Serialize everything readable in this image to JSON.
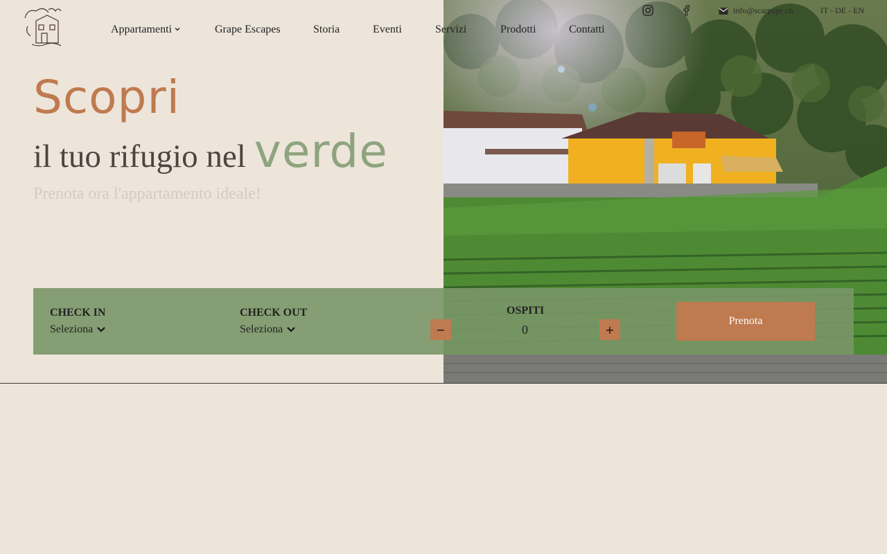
{
  "header": {
    "nav": [
      {
        "label": "Appartamenti",
        "has_dropdown": true
      },
      {
        "label": "Grape Escapes"
      },
      {
        "label": "Storia"
      },
      {
        "label": "Eventi"
      },
      {
        "label": "Servizi"
      },
      {
        "label": "Prodotti"
      },
      {
        "label": "Contatti"
      }
    ],
    "email": "info@scarpape.ch",
    "languages": "IT - DE - EN"
  },
  "hero": {
    "title_word": "Scopri",
    "subtitle_plain": "il tuo rifugio nel",
    "subtitle_accent": "verde",
    "tagline": "Prenota ora l'appartamento ideale!"
  },
  "booking": {
    "checkin_label": "CHECK IN",
    "checkin_value": "Seleziona",
    "checkout_label": "CHECK OUT",
    "checkout_value": "Seleziona",
    "guests_label": "OSPITI",
    "guests_value": "0",
    "minus": "−",
    "plus": "+",
    "submit": "Prenota"
  },
  "icons": {
    "instagram": "instagram-icon",
    "facebook": "facebook-icon",
    "mail": "mail-icon",
    "chevron": "chevron-down-icon"
  },
  "colors": {
    "background": "#ede5da",
    "accent_terracotta": "#bf7a4f",
    "accent_green": "#8fa47e",
    "booking_bar": "#799667"
  }
}
